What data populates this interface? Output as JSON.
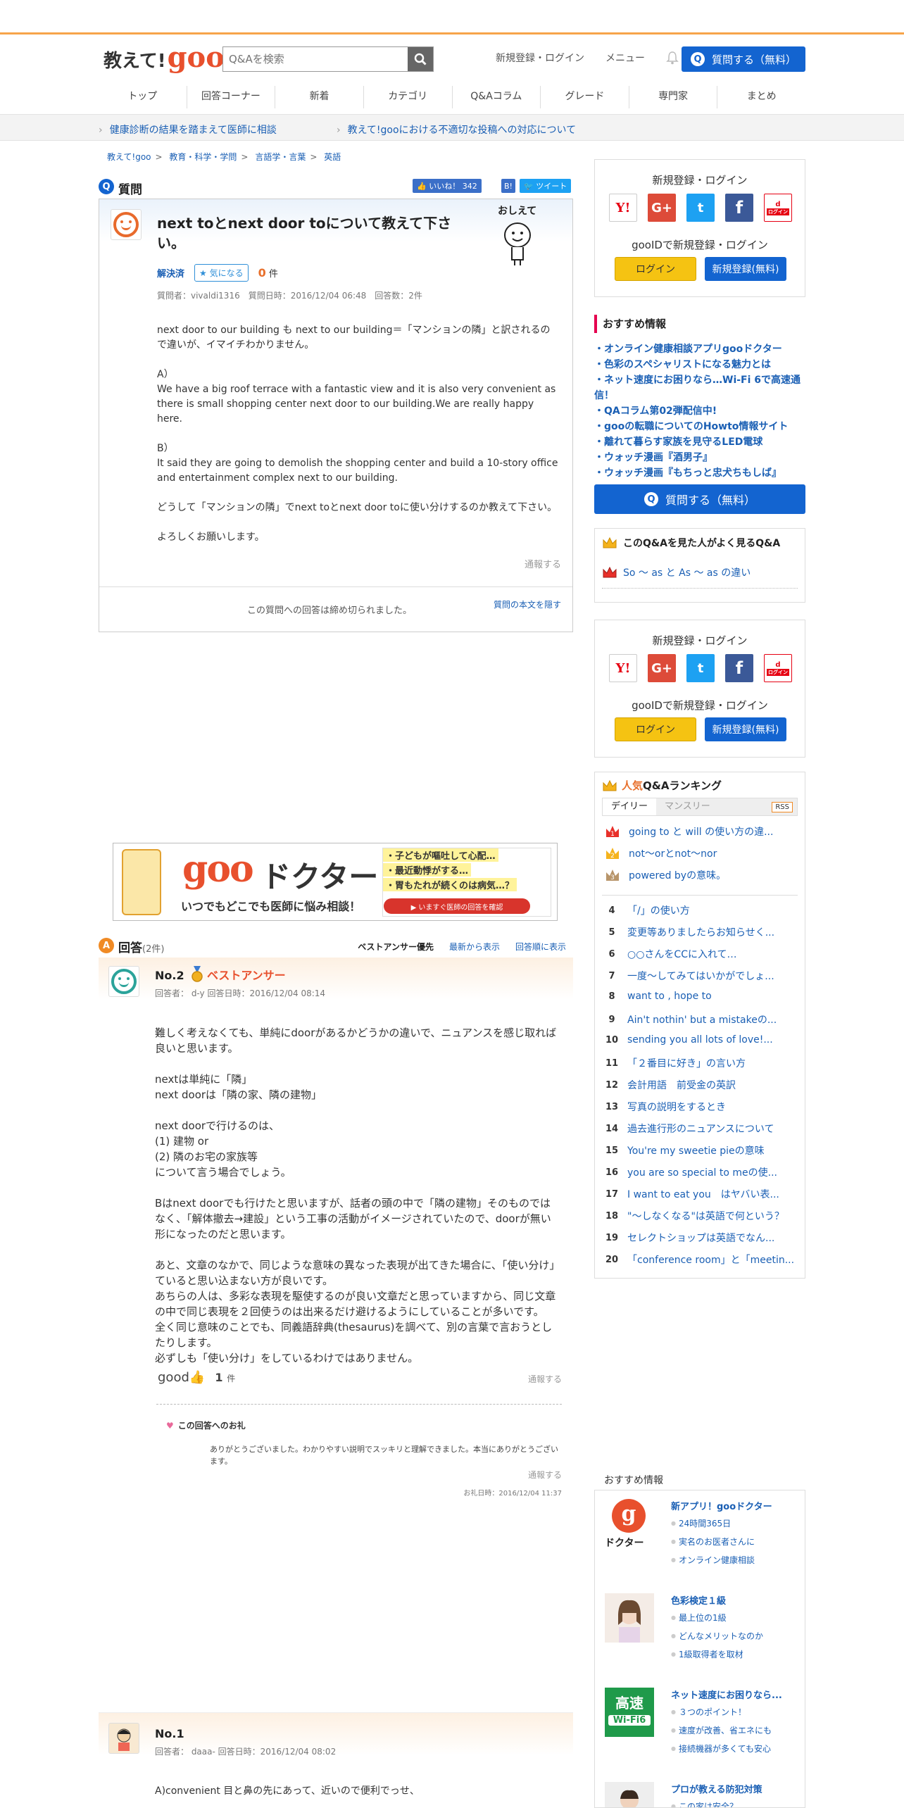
{
  "header": {
    "logo_text": "教えて!",
    "logo_goo": "goo",
    "search_placeholder": "Q&Aを検索",
    "links": [
      "新規登録・ログイン",
      "メニュー"
    ],
    "ask_button": "質問する（無料）"
  },
  "nav": [
    "トップ",
    "回答コーナー",
    "新着",
    "カテゴリ",
    "Q&Aコラム",
    "グレード",
    "専門家",
    "まとめ"
  ],
  "notices": [
    "健康診断の結果を踏まえて医師に相談",
    "教えて!gooにおける不適切な投稿への対応について"
  ],
  "breadcrumb": [
    "教えて!goo",
    "教育・科学・学問",
    "言語学・言葉",
    "英語"
  ],
  "question": {
    "section_label": "質問",
    "like_label": "いいね！",
    "like_count": "342",
    "hatena": "B!",
    "tweet": "ツイート",
    "title": "next toとnext door toについて教えて下さい。",
    "mascot_text": "おしえて",
    "status": "解決済",
    "watch_label": "気になる",
    "watch_count": "0",
    "watch_unit": "件",
    "meta": "質問者：vivaldi1316　質問日時：2016/12/04 06:48　回答数：2件",
    "body": "next door to our building も next to our building＝「マンションの隣」と訳されるので違いが、イマイチわかりません。\n\nA）\nWe have a big roof terrace with a fantastic view and it is also very convenient as there is small shopping center next door to our building.We are really happy here.\n\nB）\nIt said they are going to demolish the shopping center and build a 10-story office and entertainment complex next to our building.\n\nどうして「マンションの隣」でnext toとnext door toに使い分けするのか教えて下さい。\n\nよろしくお願いします。",
    "report": "通報する",
    "closed": "この質問への回答は締め切られました。",
    "hide": "質問の本文を隠す"
  },
  "banner": {
    "goo": "goo",
    "doctor": "ドクター",
    "subtitle": "いつでもどこでも医師に悩み相談！",
    "bullets": [
      "・子どもが嘔吐して心配…",
      "・最近動悸がする…",
      "・胃もたれが続くのは病気…？"
    ],
    "button": "▶ いますぐ医師の回答を確認"
  },
  "answers_header": {
    "label": "回答",
    "count": "(2件)",
    "sorts": [
      "ベストアンサー優先",
      "最新から表示",
      "回答順に表示"
    ]
  },
  "answers": [
    {
      "no": "No.2",
      "best": "ベストアンサー",
      "meta": "回答者：  d-y    回答日時：2016/12/04 08:14",
      "body": "難しく考えなくても、単純にdoorがあるかどうかの違いで、ニュアンスを感じ取れば良いと思います。\n\nnextは単純に「隣」\nnext doorは「隣の家、隣の建物」\n\nnext doorで行けるのは、\n(1) 建物 or\n(2) 隣のお宅の家族等\nについて言う場合でしょう。\n\nBはnext doorでも行けたと思いますが、話者の頭の中で「隣の建物」そのものではなく、「解体撤去→建設」という工事の活動がイメージされていたので、doorが無い形になったのだと思います。\n\nあと、文章のなかで、同じような意味の異なった表現が出てきた場合に、「使い分け」ていると思い込まない方が良いです。\nあちらの人は、多彩な表現を駆使するのが良い文章だと思っていますから、同じ文章の中で同じ表現を２回使うのは出来るだけ避けるようにしていることが多いです。\n全く同じ意味のことでも、同義語辞典(thesaurus)を調べて、別の言葉で言おうとしたりします。\n必ずしも「使い分け」をしているわけではありません。",
      "good": "good",
      "good_count": "1",
      "good_unit": "件",
      "report": "通報する",
      "thanks_label": "この回答へのお礼",
      "thanks_body": "ありがとうございました。わかりやすい説明でスッキリと理解できました。本当にありがとうございます。",
      "thanks_report": "通報する",
      "thanks_date": "お礼日時：2016/12/04 11:37"
    },
    {
      "no": "No.1",
      "meta": "回答者：  daaa-    回答日時：2016/12/04 08:02",
      "body": "A)convenient 目と鼻の先にあって、近いので便利でっせ、"
    }
  ],
  "sidebar": {
    "login_title": "新規登録・ログイン",
    "gooid_title": "gooIDで新規登録・ログイン",
    "login_btn": "ログイン",
    "register_btn": "新規登録(無料)",
    "sns": [
      "Y!",
      "G+",
      "t",
      "f",
      "d"
    ],
    "docomo_sub": "ログイン",
    "rec_title": "おすすめ情報",
    "rec_items": [
      "オンライン健康相談アプリgooドクター",
      "色彩のスペシャリストになる魅力とは",
      "ネット速度にお困りなら…Wi-Fi 6で高速通信！",
      "QAコラム第02弾配信中!",
      "gooの転職についてのHowto情報サイト",
      "離れて暮らす家族を見守るLED電球",
      "ウォッチ漫画『酒男子』",
      "ウォッチ漫画『もちっと忠犬ちもしば』"
    ],
    "ask_button": "質問する（無料）",
    "seen_title": "このQ&Aを見た人がよく見るQ&A",
    "seen_item": "So ～ as と As ～ as の違い",
    "ranking_title_a": "人気",
    "ranking_title_b": "Q&Aランキング",
    "ranking_tabs": [
      "デイリー",
      "マンスリー"
    ],
    "rss": "RSS",
    "ranking": [
      {
        "n": "1",
        "t": "going to と will の使い方の違..."
      },
      {
        "n": "2",
        "t": "not～orとnot～nor"
      },
      {
        "n": "3",
        "t": "powered byの意味。"
      },
      {
        "n": "4",
        "t": "「/」の使い方"
      },
      {
        "n": "5",
        "t": "変更等ありましたらお知らせく..."
      },
      {
        "n": "6",
        "t": "○○さんをCCに入れて…"
      },
      {
        "n": "7",
        "t": "一度～してみてはいかがでしょ..."
      },
      {
        "n": "8",
        "t": "want to , hope to"
      },
      {
        "n": "9",
        "t": "Ain't nothin' but a mistakeの..."
      },
      {
        "n": "10",
        "t": "sending you all lots of love!..."
      },
      {
        "n": "11",
        "t": "「２番目に好き」の言い方"
      },
      {
        "n": "12",
        "t": "会計用語　前受金の英訳"
      },
      {
        "n": "13",
        "t": "写真の説明をするとき"
      },
      {
        "n": "14",
        "t": "過去進行形のニュアンスについて"
      },
      {
        "n": "15",
        "t": "You're my sweetie pieの意味"
      },
      {
        "n": "16",
        "t": "you are so special to meの使..."
      },
      {
        "n": "17",
        "t": "I want to eat you　はヤバい表..."
      },
      {
        "n": "18",
        "t": "\"～しなくなる\"は英語で何という？"
      },
      {
        "n": "19",
        "t": "セレクトショップは英語でなん..."
      },
      {
        "n": "20",
        "t": "「conference room」と「meetin..."
      }
    ],
    "rec2_title": "おすすめ情報",
    "rec2": [
      {
        "title": "新アプリ！gooドクター",
        "subs": [
          "24時間365日",
          "実名のお医者さんに",
          "オンライン健康相談"
        ],
        "img_text": "ドクター"
      },
      {
        "title": "色彩検定１級",
        "subs": [
          "最上位の1級",
          "どんなメリットなのか",
          "1級取得者を取材"
        ]
      },
      {
        "title": "ネット速度にお困りなら...",
        "subs": [
          "３つのポイント！",
          "速度が改善、省エネにも",
          "接続機器が多くても安心"
        ],
        "img_text": "高速",
        "img_text2": "Wi-Fi6"
      },
      {
        "title": "プロが教える防犯対策",
        "subs": [
          "この家は安全？"
        ]
      }
    ]
  }
}
